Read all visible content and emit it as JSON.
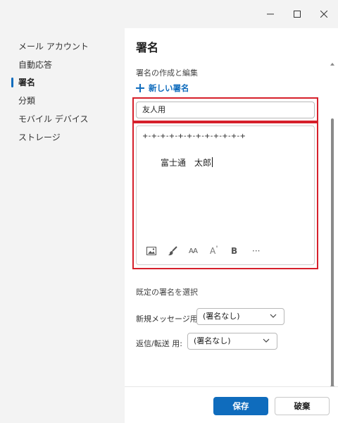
{
  "window": {
    "controls": [
      "minimize-icon",
      "maximize-icon",
      "close-icon"
    ]
  },
  "sidebar": {
    "items": [
      {
        "label": "メール アカウント",
        "active": false
      },
      {
        "label": "自動応答",
        "active": false
      },
      {
        "label": "署名",
        "active": true
      },
      {
        "label": "分類",
        "active": false
      },
      {
        "label": "モバイル デバイス",
        "active": false
      },
      {
        "label": "ストレージ",
        "active": false
      }
    ]
  },
  "main": {
    "title": "署名",
    "create_edit_label": "署名の作成と編集",
    "new_signature_label": "新しい署名",
    "signature_name": "友人用",
    "editor": {
      "line1": "+-+-+-+-+-+-+-+-+-+-+-+",
      "line2": "富士通　太郎"
    },
    "toolbar": {
      "font_size_label": "AA",
      "font_color_label": "A",
      "bold_label": "B",
      "more_label": "···"
    },
    "default_section_label": "既定の署名を選択",
    "new_message_label": "新規メッセージ用:",
    "new_message_value": "(署名なし)",
    "reply_forward_label": "返信/転送 用:",
    "reply_forward_value": "(署名なし)"
  },
  "footer": {
    "save_label": "保存",
    "discard_label": "破棄"
  },
  "colors": {
    "accent": "#0f6cbd",
    "highlight": "#d6202b"
  }
}
